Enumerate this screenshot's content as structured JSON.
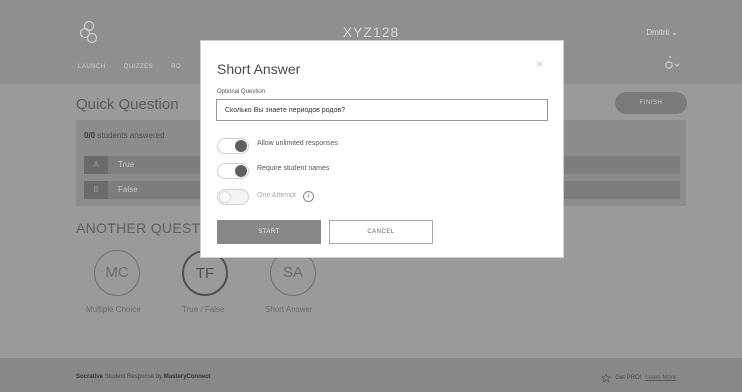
{
  "header": {
    "room": "XYZ128",
    "user": "Dmitrii ⌄",
    "nav": [
      "LAUNCH",
      "QUIZZES",
      "RO"
    ]
  },
  "main": {
    "title": "Quick Question",
    "finish_label": "FINISH",
    "answered_count": "0/0",
    "answered_text": "students answered",
    "answers": [
      {
        "letter": "A",
        "text": "True"
      },
      {
        "letter": "B",
        "text": "False"
      }
    ],
    "another_heading": "ANOTHER QUESTION",
    "question_types": [
      {
        "abbr": "MC",
        "label": "Multiple Choice"
      },
      {
        "abbr": "TF",
        "label": "True / False"
      },
      {
        "abbr": "SA",
        "label": "Short Answer"
      }
    ]
  },
  "footer": {
    "brand": "Socrative",
    "text": "Student Response by",
    "company": "MasteryConnect",
    "pro": "Get PRO!",
    "learn": "Learn More"
  },
  "modal": {
    "title": "Short Answer",
    "close": "×",
    "question_label": "Optional Question",
    "question_value": "Сколько Вы знаете периодов родов?",
    "toggles": [
      {
        "label": "Allow unlimited responses",
        "on": true
      },
      {
        "label": "Require student names",
        "on": true
      },
      {
        "label": "One Attempt",
        "on": false
      }
    ],
    "info": "i",
    "start_label": "START",
    "cancel_label": "CANCEL"
  }
}
